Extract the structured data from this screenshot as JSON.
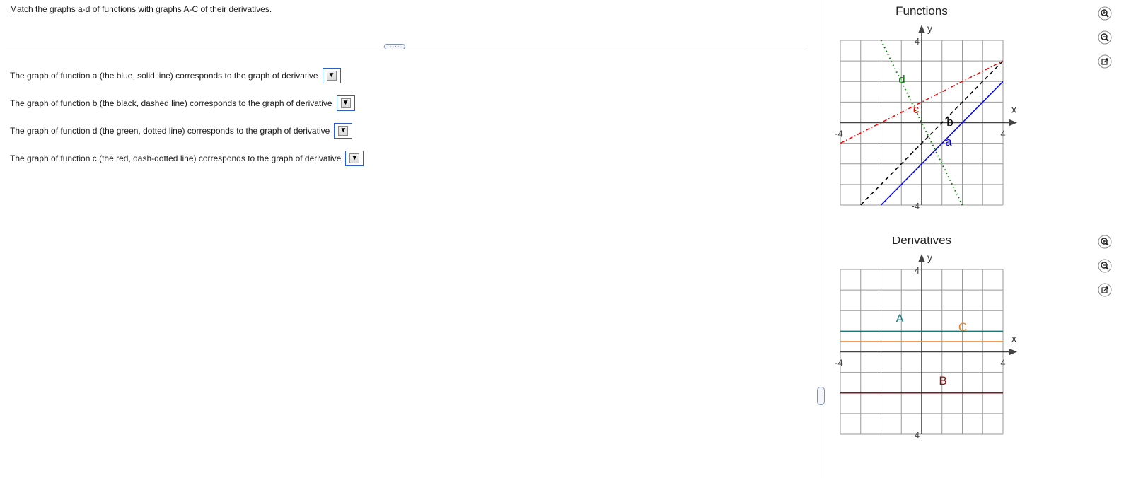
{
  "instructions": "Match the graphs a-d of functions with graphs A-C of their derivatives.",
  "handle_glyph": "····",
  "questions": [
    {
      "text": "The graph of function a (the blue, solid line) corresponds to the graph of derivative",
      "selected": "",
      "arrow": "▼"
    },
    {
      "text": "The graph of function b (the black, dashed line) corresponds to the graph of derivative",
      "selected": "",
      "arrow": "▼"
    },
    {
      "text": "The graph of function d (the green, dotted line) corresponds to the graph of derivative",
      "selected": "",
      "arrow": "▼"
    },
    {
      "text": "The graph of function c (the red, dash-dotted line) corresponds to the graph of derivative",
      "selected": "",
      "arrow": "▼"
    }
  ],
  "chart_data": [
    {
      "type": "line",
      "title": "Functions",
      "xlabel": "x",
      "ylabel": "y",
      "xlim": [
        -4,
        4
      ],
      "ylim": [
        -4,
        4
      ],
      "ticks": {
        "xmin": "-4",
        "xmax": "4",
        "ymin": "-4",
        "ymax": "4"
      },
      "grid": true,
      "series": [
        {
          "name": "a",
          "color": "#0000ff",
          "style": "solid",
          "x": [
            -2,
            4
          ],
          "y": [
            -4,
            2
          ]
        },
        {
          "name": "b",
          "color": "#000000",
          "style": "dashed",
          "x": [
            -3,
            4
          ],
          "y": [
            -4,
            3
          ]
        },
        {
          "name": "c",
          "color": "#ff0000",
          "style": "dash-dotted",
          "x": [
            -4,
            4
          ],
          "y": [
            -1,
            3
          ]
        },
        {
          "name": "d",
          "color": "#008000",
          "style": "dotted",
          "x": [
            -2,
            2
          ],
          "y": [
            4,
            -4
          ]
        }
      ]
    },
    {
      "type": "line",
      "title": "Derivatives",
      "xlabel": "x",
      "ylabel": "y",
      "xlim": [
        -4,
        4
      ],
      "ylim": [
        -4,
        4
      ],
      "ticks": {
        "xmin": "-4",
        "xmax": "4",
        "ymin": "-4",
        "ymax": "4"
      },
      "grid": true,
      "series": [
        {
          "name": "A",
          "color": "#1a7a7a",
          "style": "solid",
          "x": [
            -4,
            4
          ],
          "y": [
            1,
            1
          ]
        },
        {
          "name": "B",
          "color": "#8b1010",
          "style": "solid",
          "x": [
            -4,
            4
          ],
          "y": [
            -2,
            -2
          ]
        },
        {
          "name": "C",
          "color": "#f08020",
          "style": "solid",
          "x": [
            -4,
            4
          ],
          "y": [
            0.5,
            0.5
          ]
        }
      ]
    }
  ],
  "tools": [
    "zoom-in-icon",
    "zoom-out-icon",
    "open-external-icon"
  ]
}
